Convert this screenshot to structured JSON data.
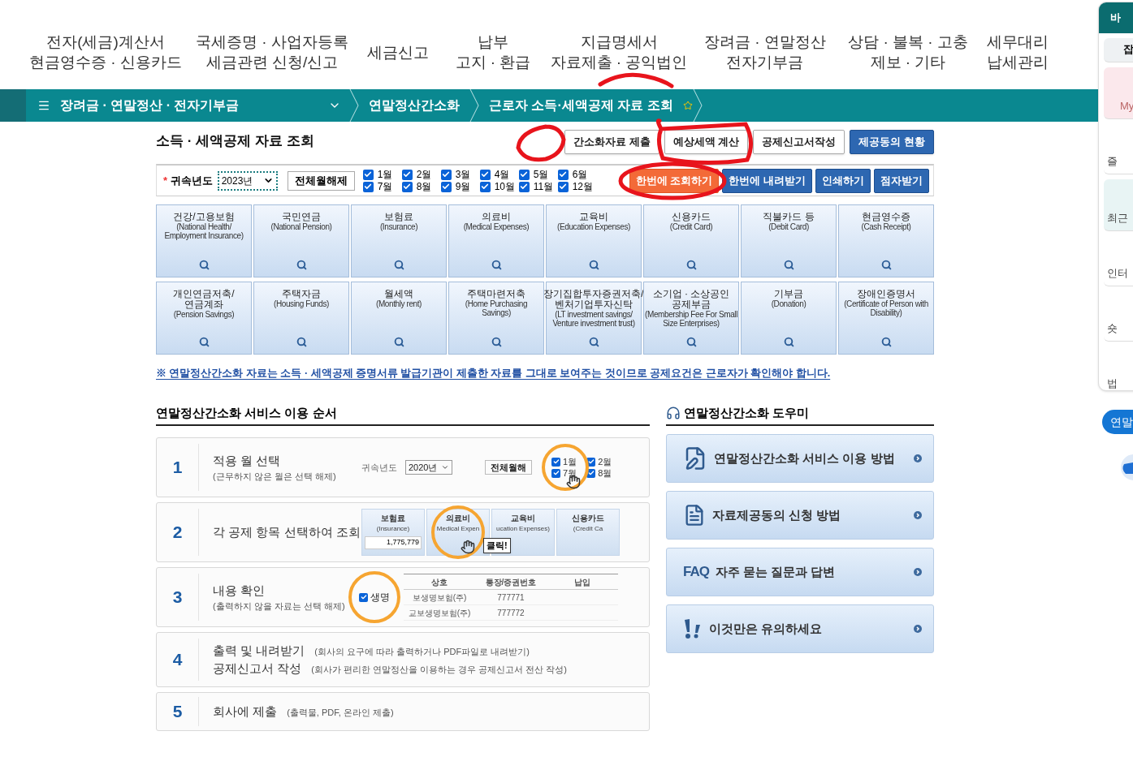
{
  "top_nav": [
    {
      "lines": [
        "전자(세금)계산서",
        "현금영수증 · 신용카드"
      ]
    },
    {
      "lines": [
        "국세증명 · 사업자등록",
        "세금관련 신청/신고"
      ]
    },
    {
      "lines": [
        "세금신고"
      ]
    },
    {
      "lines": [
        "납부",
        "고지 · 환급"
      ]
    },
    {
      "lines": [
        "지급명세서",
        "자료제출 · 공익법인"
      ]
    },
    {
      "lines": [
        "장려금 · 연말정산",
        "전자기부금"
      ]
    },
    {
      "lines": [
        "상담 · 불복 · 고충",
        "제보 · 기타"
      ]
    },
    {
      "lines": [
        "세무대리",
        "납세관리"
      ]
    }
  ],
  "breadcrumb": {
    "menu": "장려금 · 연말정산 · 전자기부금",
    "items": [
      "연말정산간소화",
      "근로자 소득·세액공제 자료 조회"
    ]
  },
  "page_title": "소득 · 세액공제 자료 조회",
  "header_buttons": [
    {
      "label": "간소화자료 제출",
      "kind": "plain"
    },
    {
      "label": "예상세액 계산",
      "kind": "plain"
    },
    {
      "label": "공제신고서작성",
      "kind": "plain"
    },
    {
      "label": "제공동의 현황",
      "kind": "primary"
    }
  ],
  "filter": {
    "required_mark": "*",
    "year_label": "귀속년도",
    "year": "2023년",
    "clear_button": "전체월해제",
    "months": [
      {
        "label": "1월",
        "checked": true
      },
      {
        "label": "7월",
        "checked": true
      },
      {
        "label": "2월",
        "checked": true
      },
      {
        "label": "8월",
        "checked": true
      },
      {
        "label": "3월",
        "checked": true
      },
      {
        "label": "9월",
        "checked": true
      },
      {
        "label": "4월",
        "checked": true
      },
      {
        "label": "10월",
        "checked": true
      },
      {
        "label": "5월",
        "checked": true
      },
      {
        "label": "11월",
        "checked": true
      },
      {
        "label": "6월",
        "checked": true
      },
      {
        "label": "12월",
        "checked": true
      }
    ],
    "buttons": [
      {
        "label": "한번에 조회하기",
        "kind": "accent"
      },
      {
        "label": "한번에 내려받기",
        "kind": "primary"
      },
      {
        "label": "인쇄하기",
        "kind": "primary"
      },
      {
        "label": "점자받기",
        "kind": "primary"
      }
    ]
  },
  "categories": [
    {
      "title_lines": [
        "건강/고용보험"
      ],
      "sub": "(National Health/ Employment Insurance)"
    },
    {
      "title_lines": [
        "국민연금"
      ],
      "sub": "(National Pension)"
    },
    {
      "title_lines": [
        "보험료"
      ],
      "sub": "(Insurance)"
    },
    {
      "title_lines": [
        "의료비"
      ],
      "sub": "(Medical Expenses)"
    },
    {
      "title_lines": [
        "교육비"
      ],
      "sub": "(Education Expenses)"
    },
    {
      "title_lines": [
        "신용카드"
      ],
      "sub": "(Credit Card)"
    },
    {
      "title_lines": [
        "직불카드 등"
      ],
      "sub": "(Debit Card)"
    },
    {
      "title_lines": [
        "현금영수증"
      ],
      "sub": "(Cash Receipt)"
    },
    {
      "title_lines": [
        "개인연금저축/",
        "연금계좌"
      ],
      "sub": "(Pension Savings)"
    },
    {
      "title_lines": [
        "주택자금"
      ],
      "sub": "(Housing Funds)"
    },
    {
      "title_lines": [
        "월세액"
      ],
      "sub": "(Monthly rent)"
    },
    {
      "title_lines": [
        "주택마련저축"
      ],
      "sub": "(Home Purchasing Savings)"
    },
    {
      "title_lines": [
        "장기집합투자증권저축/",
        "벤처기업투자신탁"
      ],
      "sub": "(LT investment savings/ Venture investment trust)"
    },
    {
      "title_lines": [
        "소기업 · 소상공인",
        "공제부금"
      ],
      "sub": "(Membership Fee For Small Size Enterprises)"
    },
    {
      "title_lines": [
        "기부금"
      ],
      "sub": "(Donation)"
    },
    {
      "title_lines": [
        "장애인증명서"
      ],
      "sub": "(Certificate of Person with Disability)"
    }
  ],
  "notice": "※ 연말정산간소화 자료는 소득 · 세액공제 증명서류 발급기관이 제출한 자료를 그대로 보여주는 것이므로 공제요건은 근로자가 확인해야 합니다.",
  "steps_title": "연말정산간소화 서비스 이용 순서",
  "steps": [
    {
      "number": "1",
      "kind": "stacked",
      "lines": [
        {
          "title": "적용 월 선택",
          "note": "(근무하지 않은 월은 선택 해제)"
        }
      ],
      "illustration": {
        "kind": "months",
        "year_label": "귀속년도",
        "year": "2020년",
        "button": "전체월해",
        "months": [
          {
            "label": "1월",
            "checked": true
          },
          {
            "label": "7월",
            "checked": true
          },
          {
            "label": "2월",
            "checked": true
          },
          {
            "label": "8월",
            "checked": true
          }
        ]
      }
    },
    {
      "number": "2",
      "kind": "stacked",
      "lines": [
        {
          "title": "각 공제 항목 선택하여 조회"
        }
      ],
      "illustration": {
        "kind": "tiles",
        "callout": "클릭!",
        "tiles": [
          {
            "title": "보험료",
            "sub": "(Insurance)",
            "value": "1,775,779"
          },
          {
            "title": "의료비",
            "sub": "Medical Expen"
          },
          {
            "title": "교육비",
            "sub": "ucation Expenses)"
          },
          {
            "title": "신용카드",
            "sub": "(Credit Ca"
          }
        ]
      }
    },
    {
      "number": "3",
      "kind": "stacked",
      "lines": [
        {
          "title": "내용 확인",
          "note": "(출력하지 않을 자료는 선택 해제)"
        }
      ],
      "illustration": {
        "kind": "table",
        "zoom_checked": true,
        "zoom_text": "생명",
        "columns": [
          "상호",
          "통장/증권번호",
          "납입"
        ],
        "rows": [
          [
            "보생명보험(주)",
            "777771"
          ],
          [
            "교보생명보험(주)",
            "777772"
          ]
        ]
      }
    },
    {
      "number": "4",
      "kind": "inline",
      "lines": [
        {
          "title": "출력 및 내려받기",
          "note": "(회사의 요구에 따라 출력하거나 PDF파일로 내려받기)"
        },
        {
          "title": "공제신고서 작성",
          "note": "(회사가 편리한 연말정산을 이용하는 경우 공제신고서 전산 작성)"
        }
      ]
    },
    {
      "number": "5",
      "kind": "inline",
      "lines": [
        {
          "title": "회사에 제출",
          "note": "(출력물, PDF, 온라인 제출)"
        }
      ]
    }
  ],
  "helper_title": "연말정산간소화 도우미",
  "helper_items": [
    {
      "kind": "guide",
      "label": "연말정산간소화 서비스 이용 방법"
    },
    {
      "kind": "document",
      "label": "자료제공동의 신청 방법"
    },
    {
      "kind": "faq",
      "badge": "FAQ",
      "label": "자주 묻는 질문과 답변"
    },
    {
      "kind": "caution",
      "label": "이것만은 유의하세요"
    }
  ],
  "quick_panel": {
    "title": "바",
    "items": [
      {
        "label": "잡",
        "kind": "gray"
      },
      {
        "label": "My",
        "kind": "pink"
      },
      {
        "label": "즐",
        "kind": "plain"
      },
      {
        "label": "최근",
        "kind": "mint"
      },
      {
        "label": "인터",
        "kind": "plain"
      },
      {
        "label": "숏",
        "kind": "plain"
      },
      {
        "label": "법",
        "kind": "plain"
      }
    ]
  },
  "floating_pill": "연말"
}
